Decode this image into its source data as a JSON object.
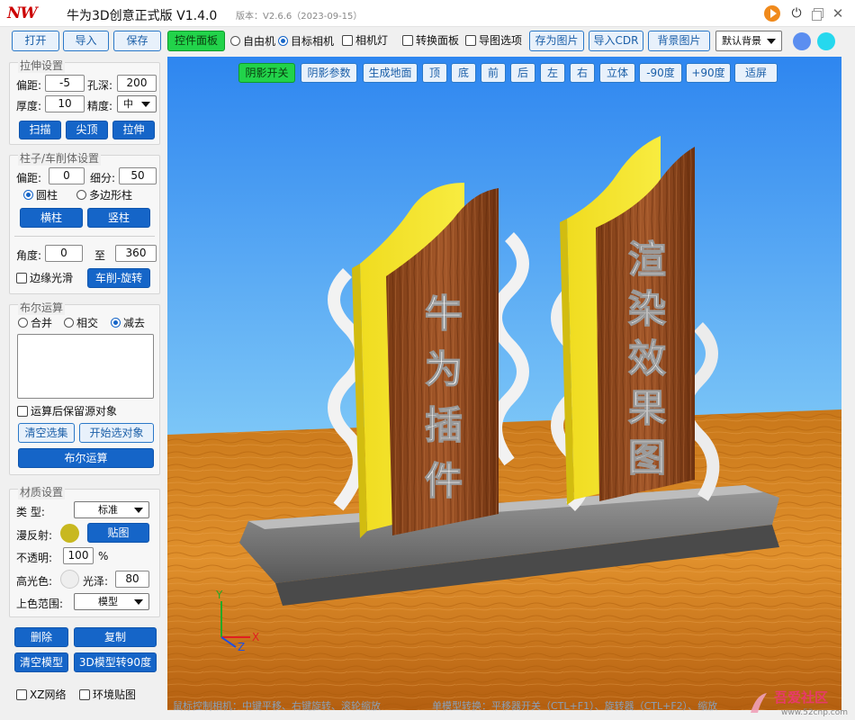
{
  "title": {
    "app_title": "牛为3D创意正式版 V1.4.0",
    "version": "版本：V2.6.6（2023-09-15）"
  },
  "toolbar": {
    "open": "打开",
    "import": "导入",
    "save": "保存",
    "control_panel": "控件面板",
    "free_camera": "自由机",
    "target_camera": "目标相机",
    "camera_light": "相机灯",
    "convert_panel": "转换面板",
    "import_options": "导图选项",
    "save_image": "存为图片",
    "import_cdr": "导入CDR",
    "background_image": "背景图片",
    "background_select": "默认背景",
    "color_1": "#5b8ef0",
    "color_2": "#26d8ee"
  },
  "view_toolbar": {
    "shadow_toggle": "阴影开关",
    "shadow_params": "阴影参数",
    "generate_ground": "生成地面",
    "top": "顶",
    "bottom": "底",
    "front": "前",
    "back": "后",
    "left": "左",
    "right": "右",
    "iso": "立体",
    "minus90": "-90度",
    "plus90": "+90度",
    "fit": "适屏"
  },
  "extrude": {
    "title": "拉伸设置",
    "offset_label": "偏距:",
    "offset_value": "-5",
    "hole_depth_label": "孔深:",
    "hole_depth_value": "200",
    "thickness_label": "厚度:",
    "thickness_value": "10",
    "precision_label": "精度:",
    "precision_value": "中",
    "scan": "扫描",
    "tip": "尖顶",
    "extrude": "拉伸"
  },
  "pillar": {
    "title": "柱子/车削体设置",
    "offset_label": "偏距:",
    "offset_value": "0",
    "subdiv_label": "细分:",
    "subdiv_value": "50",
    "cylinder": "圆柱",
    "polygon": "多边形柱",
    "horizontal": "横柱",
    "vertical": "竖柱",
    "angle_label": "角度:",
    "angle_from": "0",
    "to_label": "至",
    "angle_to": "360",
    "edge_smooth": "边缘光滑",
    "lathe": "车削-旋转"
  },
  "boolean": {
    "title": "布尔运算",
    "union": "合并",
    "intersect": "相交",
    "subtract": "减去",
    "keep_source": "运算后保留源对象",
    "clear_selection": "清空选集",
    "start_select": "开始选对象",
    "run": "布尔运算"
  },
  "material": {
    "title": "材质设置",
    "type_label": "类  型:",
    "type_value": "标准",
    "diffuse_label": "漫反射:",
    "diffuse_color": "#c8b820",
    "texture": "贴图",
    "opacity_label": "不透明:",
    "opacity_value": "100",
    "opacity_unit": "%",
    "specular_label": "高光色:",
    "specular_color": "#eeeeee",
    "gloss_label": "光泽:",
    "gloss_value": "80",
    "range_label": "上色范围:",
    "range_value": "模型"
  },
  "actions": {
    "delete": "删除",
    "copy": "复制",
    "clear_model": "清空模型",
    "rotate90": "3D模型转90度",
    "xz_grid": "XZ网络",
    "env_map": "环境贴图"
  },
  "scene": {
    "sign_left": [
      "牛",
      "为",
      "插",
      "件"
    ],
    "sign_right": [
      "渲",
      "染",
      "效",
      "果",
      "图"
    ],
    "axis_x": "X",
    "axis_y": "Y",
    "axis_z": "Z"
  },
  "status": {
    "left": "鼠标控制相机：中键平移、右键旋转、滚轮缩放",
    "right": "单模型转换：平移器开关（CTL+F1）、旋转器（CTL+F2）、缩放"
  },
  "watermark": {
    "name": "吾爱社区",
    "url": "www.52cnp.com"
  }
}
